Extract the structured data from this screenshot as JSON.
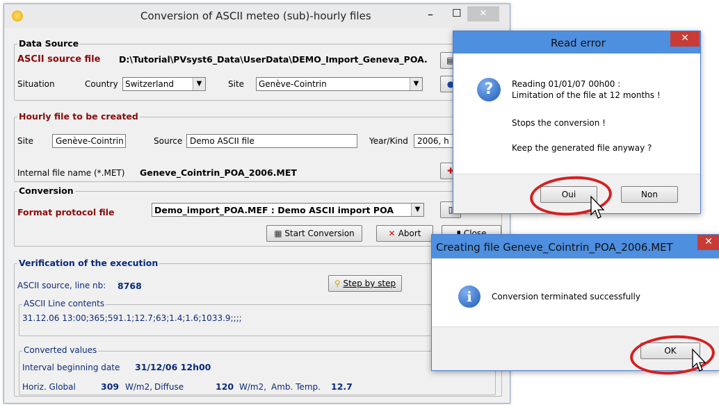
{
  "main_window": {
    "title": "Conversion of ASCII meteo (sub)-hourly files",
    "controls": {
      "minimize": "–",
      "maximize": "☐",
      "close": "✕"
    },
    "data_source": {
      "group_title": "Data Source",
      "ascii_label": "ASCII source file",
      "ascii_path": "D:\\Tutorial\\PVsyst6_Data\\UserData\\DEMO_Import_Geneva_POA.",
      "situation_label": "Situation",
      "country_label": "Country",
      "country_value": "Switzerland",
      "site_label": "Site",
      "site_value": "Genève-Cointrin"
    },
    "hourly_file": {
      "group_title": "Hourly file to be created",
      "site_label": "Site",
      "site_value": "Genève-Cointrin",
      "source_label": "Source",
      "source_value": "Demo ASCII file",
      "yearkind_label": "Year/Kind",
      "yearkind_value": "2006, h",
      "internal_label": "Internal file name  (*.MET)",
      "internal_value": "Geneve_Cointrin_POA_2006.MET"
    },
    "conversion": {
      "group_title": "Conversion",
      "format_label": "Format protocol file",
      "format_value": "Demo_import_POA.MEF  : Demo ASCII import POA",
      "start_label": "Start Conversion",
      "abort_label": "Abort",
      "close_label": "Close"
    },
    "verification": {
      "group_title": "Verification of the execution",
      "line_label": "ASCII source, line nb:",
      "line_value": "8768",
      "step_label": "Step by step",
      "ascii_line_title": "ASCII Line contents",
      "ascii_line_value": "31.12.06 13:00;365;591.1;12.7;63;1.4;1.6;1033.9;;;;",
      "converted_title": "Converted values",
      "interval_label": "Interval beginning date",
      "interval_value": "31/12/06 12h00",
      "horiz_label": "Horiz. Global",
      "horiz_value": "309",
      "unit1": "W/m2,",
      "diffuse_label": "Diffuse",
      "diffuse_value": "120",
      "unit2": "W/m2,",
      "amb_label": "Amb. Temp.",
      "amb_value": "12.7"
    }
  },
  "read_error_dialog": {
    "title": "Read error",
    "close": "✕",
    "line1": "Reading   01/01/07 00h00 :",
    "line2": "Limitation of the file at 12 months !",
    "line3": "Stops the conversion !",
    "line4": "Keep the generated file anyway ?",
    "yes_label": "Oui",
    "no_label": "Non",
    "icon": "question-icon"
  },
  "creating_dialog": {
    "title": "Creating file   Geneve_Cointrin_POA_2006.MET",
    "close": "✕",
    "message": "Conversion terminated successfully",
    "ok_label": "OK",
    "icon": "info-icon"
  },
  "colors": {
    "accent_red": "#8b0a0a",
    "value_blue": "#0a2a7a",
    "highlight_circle": "#d42020",
    "dialog_title": "#4e8fe0"
  }
}
